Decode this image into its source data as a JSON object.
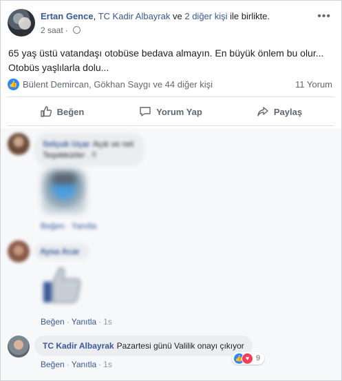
{
  "post": {
    "author": "Ertan Gence",
    "with_separator": ",",
    "with_person": "TC Kadir Albayrak",
    "with_connector": "ve",
    "with_others": "2 diğer kişi",
    "with_suffix": "ile birlikte.",
    "time": "2 saat",
    "time_sep": "·",
    "line1": "65 yaş üstü vatandaşı otobüse bedava almayın. En büyük önlem bu olur...",
    "line2": "Otobüs yaşlılarla dolu..."
  },
  "counts": {
    "likers": "Bülent Demircan, Gökhan Saygı ve 44 diğer kişi",
    "comments": "11 Yorum"
  },
  "actions": {
    "like": "Beğen",
    "comment": "Yorum Yap",
    "share": "Paylaş"
  },
  "comments": [
    {
      "name": "Selçuk Uçar",
      "text_a": "Açık ve net",
      "text_b": "Teşekkürler . !!",
      "like": "Beğen",
      "reply": "Yanıtla"
    },
    {
      "name": "Aysa Acar",
      "like": "Beğen",
      "reply": "Yanıtla",
      "time": "1s"
    },
    {
      "name": "TC Kadir Albayrak",
      "text": "Pazartesi günü Valilik onayı çıkıyor",
      "like": "Beğen",
      "reply": "Yanıtla",
      "time": "1s",
      "reaction_count": "9"
    }
  ],
  "colors": {
    "link": "#385898",
    "like_blue": "#2d88ff",
    "love_red": "#f33e58"
  },
  "icons": [
    "globe-icon",
    "more-icon",
    "like-icon",
    "comment-icon",
    "share-icon",
    "love-icon"
  ]
}
